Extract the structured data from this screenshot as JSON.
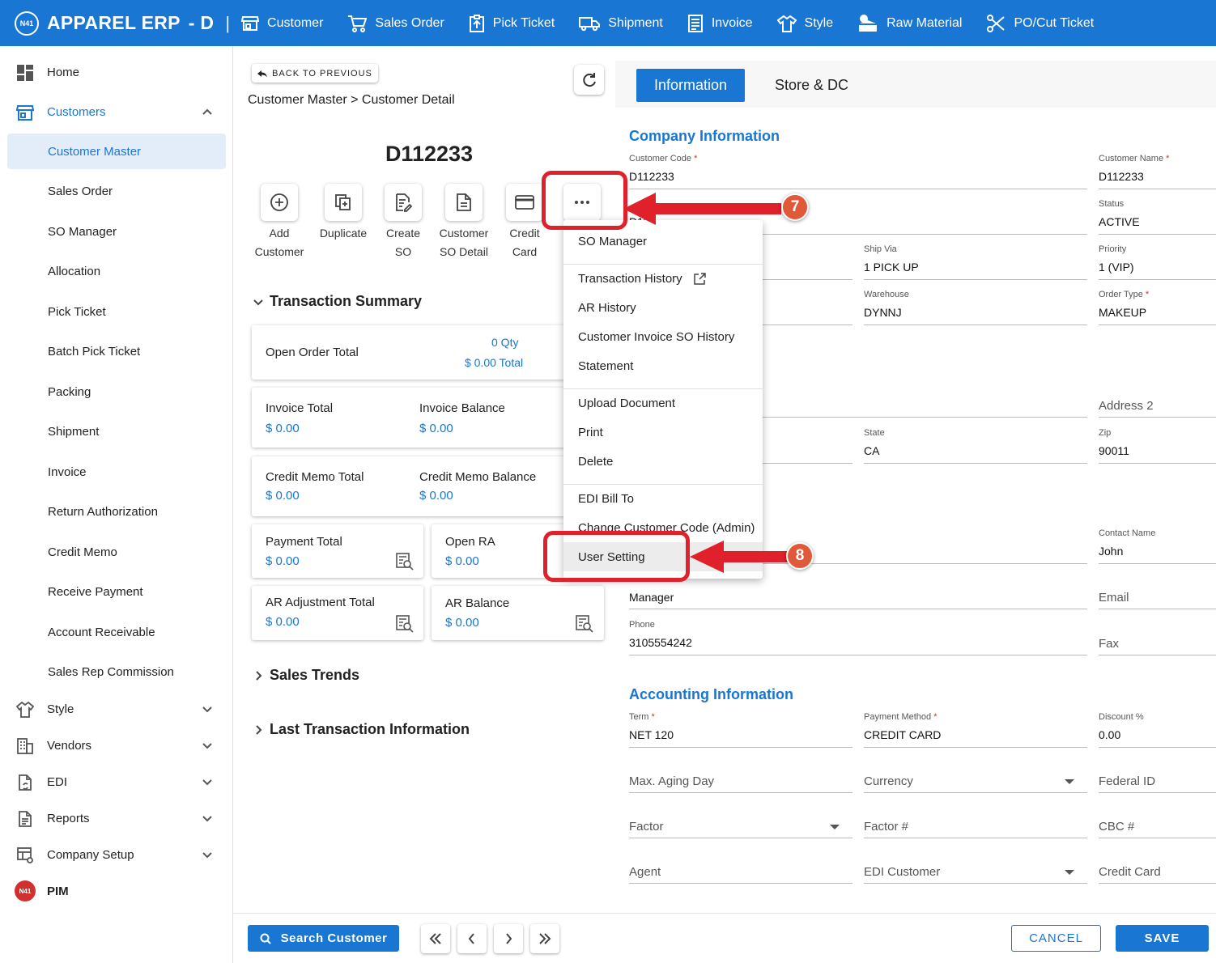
{
  "app": {
    "brand": "APPAREL ERP",
    "brand_suffix": "-  D",
    "logo_text": "N41"
  },
  "topnav": [
    {
      "label": "Customer",
      "icon": "storefront-icon"
    },
    {
      "label": "Sales Order",
      "icon": "cart-icon"
    },
    {
      "label": "Pick Ticket",
      "icon": "clipboard-upload-icon"
    },
    {
      "label": "Shipment",
      "icon": "truck-icon"
    },
    {
      "label": "Invoice",
      "icon": "receipt-icon"
    },
    {
      "label": "Style",
      "icon": "shirt-icon"
    },
    {
      "label": "Raw Material",
      "icon": "fabric-icon"
    },
    {
      "label": "PO/Cut Ticket",
      "icon": "scissors-icon"
    }
  ],
  "sidebar": {
    "home": "Home",
    "customers": "Customers",
    "sub_items": [
      "Customer Master",
      "Sales Order",
      "SO Manager",
      "Allocation",
      "Pick Ticket",
      "Batch Pick Ticket",
      "Packing",
      "Shipment",
      "Invoice",
      "Return Authorization",
      "Credit Memo",
      "Receive Payment",
      "Account Receivable",
      "Sales Rep Commission"
    ],
    "groups": [
      "Style",
      "Vendors",
      "EDI",
      "Reports",
      "Company Setup"
    ],
    "pim": "PIM"
  },
  "detail": {
    "back_label": "BACK TO PREVIOUS",
    "breadcrumb": "Customer Master > Customer Detail",
    "customer_code": "D112233",
    "actions": [
      {
        "label1": "Add",
        "label2": "Customer",
        "icon": "add-circle-icon"
      },
      {
        "label1": "Duplicate",
        "label2": "",
        "icon": "duplicate-icon"
      },
      {
        "label1": "Create",
        "label2": "SO",
        "icon": "edit-document-icon"
      },
      {
        "label1": "Customer",
        "label2": "SO Detail",
        "icon": "document-icon"
      },
      {
        "label1": "Credit",
        "label2": "Card",
        "icon": "credit-card-icon"
      }
    ],
    "more_icon": "more-horizontal-icon",
    "transaction_summary": "Transaction Summary",
    "open_order_total": "Open Order Total",
    "open_order_qty": "0 Qty",
    "open_order_amount": "$ 0.00 Total",
    "invoice_total": "Invoice Total",
    "invoice_total_val": "$ 0.00",
    "invoice_balance": "Invoice Balance",
    "invoice_balance_val": "$ 0.00",
    "credit_memo_total": "Credit Memo Total",
    "credit_memo_total_val": "$ 0.00",
    "credit_memo_balance": "Credit Memo Balance",
    "credit_memo_balance_val": "$ 0.00",
    "payment_total": "Payment Total",
    "payment_total_val": "$ 0.00",
    "open_ra": "Open RA",
    "open_ra_val": "$ 0.00",
    "ar_adjustment_total": "AR Adjustment Total",
    "ar_adjustment_total_val": "$ 0.00",
    "ar_balance": "AR Balance",
    "ar_balance_val": "$ 0.00",
    "sales_trends": "Sales Trends",
    "last_transaction": "Last Transaction Information"
  },
  "menu": {
    "so_manager": "SO Manager",
    "transaction_history": "Transaction History",
    "ar_history": "AR History",
    "invoice_so_history": "Customer Invoice SO History",
    "statement": "Statement",
    "upload_document": "Upload Document",
    "print": "Print",
    "delete": "Delete",
    "edi_bill_to": "EDI Bill To",
    "change_code": "Change Customer Code (Admin)",
    "user_setting": "User Setting"
  },
  "tabs": {
    "information": "Information",
    "store_dc": "Store & DC"
  },
  "company": {
    "heading": "Company Information",
    "customer_code_label": "Customer Code",
    "customer_code": "D112233",
    "customer_name_label": "Customer Name",
    "customer_name": "D112233",
    "dba_partial": "D11...",
    "status_label": "Status",
    "status": "ACTIVE",
    "ship_via_label": "Ship Via",
    "ship_via": "1 PICK UP",
    "priority_label": "Priority",
    "priority": "1 (VIP)",
    "warehouse_label": "Warehouse",
    "warehouse": "DYNNJ",
    "order_type_label": "Order Type",
    "order_type": "MAKEUP",
    "address2_ph": "Address 2",
    "state_label": "State",
    "state": "CA",
    "zip_label": "Zip",
    "zip": "90011",
    "contact_name_label": "Contact Name",
    "contact_name": "John",
    "manager": "Manager",
    "email_ph": "Email",
    "phone_label": "Phone",
    "phone": "3105554242",
    "fax_ph": "Fax"
  },
  "accounting": {
    "heading": "Accounting Information",
    "term_label": "Term",
    "term": "NET 120",
    "payment_method_label": "Payment Method",
    "payment_method": "CREDIT CARD",
    "discount_label": "Discount %",
    "discount": "0.00",
    "max_aging_ph": "Max. Aging Day",
    "currency_ph": "Currency",
    "federal_id_ph": "Federal ID",
    "factor_ph": "Factor",
    "factor_no_ph": "Factor #",
    "cbc_ph": "CBC #",
    "agent_ph": "Agent",
    "edi_customer_ph": "EDI Customer",
    "credit_card_ph": "Credit Card"
  },
  "bottom": {
    "search_customer": "Search Customer",
    "cancel": "CANCEL",
    "save": "SAVE"
  },
  "annotations": {
    "step7": "7",
    "step8": "8"
  },
  "colors": {
    "primary": "#1976d2",
    "highlight": "#e0202a",
    "badge": "#e05a3a"
  }
}
